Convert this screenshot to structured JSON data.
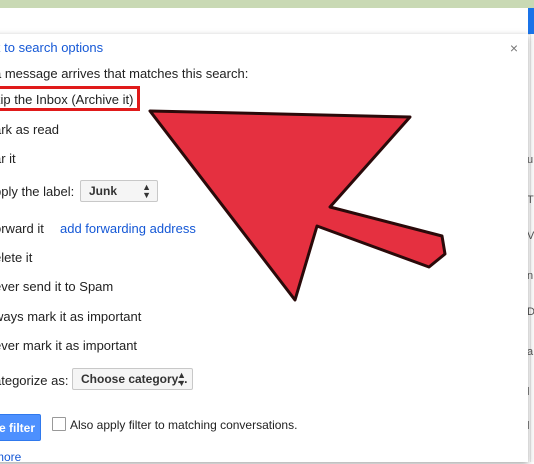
{
  "panel": {
    "back_link": "k to search options",
    "close": "×",
    "intro": "a message arrives that matches this search:",
    "options": {
      "skip_inbox": "kip the Inbox (Archive it)",
      "mark_read": "ark as read",
      "star": "ar it",
      "apply_label": "pply the label:",
      "label_value": "Junk",
      "forward": "orward it",
      "forward_link": "add forwarding address",
      "delete": "elete it",
      "never_spam": "ever send it to Spam",
      "always_important": "ways mark it as important",
      "never_important": "ever mark it as important",
      "categorize": "ategorize as:",
      "category_value": "Choose category..."
    },
    "create_button": "e filter",
    "also_apply": "Also apply filter to matching conversations.",
    "more_link": "more"
  },
  "right_edge": [
    "u",
    "T",
    "V",
    "n",
    "D",
    "a",
    "l",
    "l"
  ],
  "colors": {
    "arrow": "#e53040",
    "highlight": "#e01a1a",
    "link": "#1558d6"
  }
}
